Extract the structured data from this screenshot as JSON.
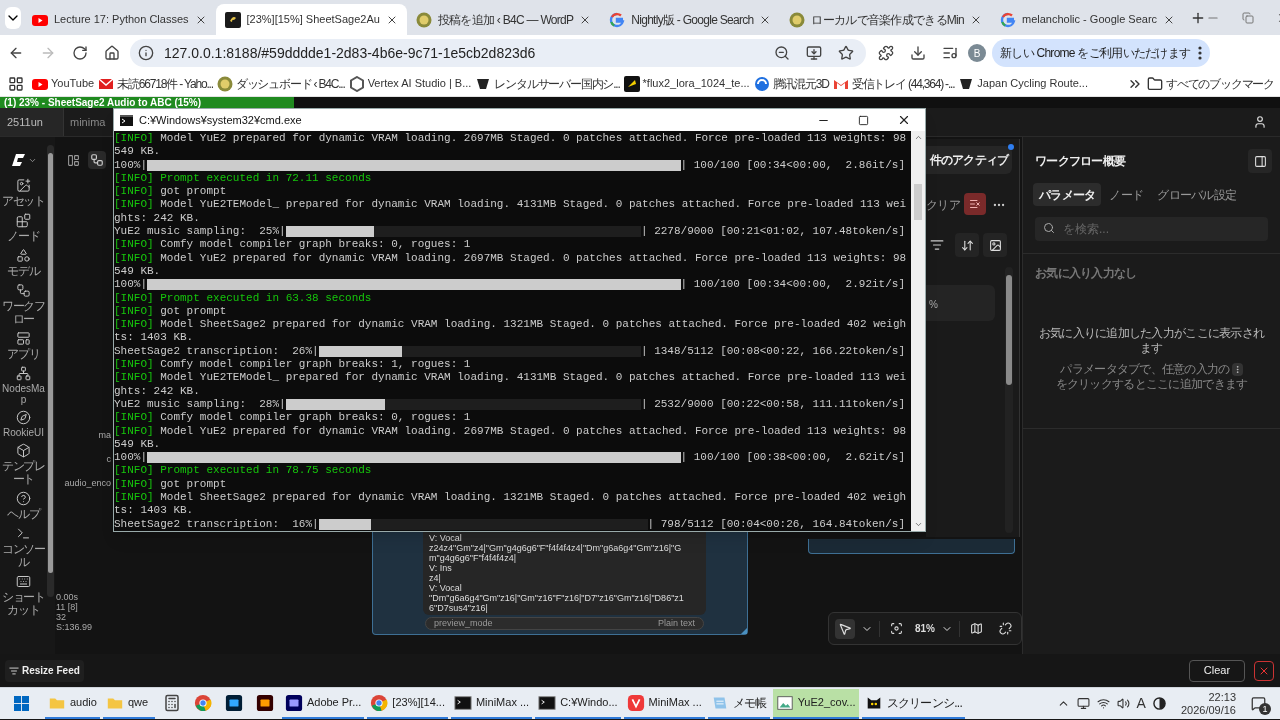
{
  "browser": {
    "tabs": [
      {
        "title": "Lecture 17: Python Classes",
        "kind": "youtube",
        "selected": false
      },
      {
        "title": "[23%][15%] SheetSage2Au",
        "kind": "app",
        "selected": true
      },
      {
        "title": "投稿を追加 ‹ B4C — WordP",
        "kind": "badge",
        "selected": false
      },
      {
        "title": "Nightly版 - Google Search",
        "kind": "google",
        "selected": false
      },
      {
        "title": "ローカルで音楽作成できるMin",
        "kind": "badge",
        "selected": false
      },
      {
        "title": "melancholic - Google Searc",
        "kind": "google",
        "selected": false
      }
    ],
    "url": "127.0.0.1:8188/#59dddde1-2d83-4b6e-9c71-1e5cb2d823d6",
    "profile": "B",
    "update_button": "新しい Chrome をご利用いただけます",
    "bookmarks": [
      {
        "label": "YouTube",
        "kind": "youtube"
      },
      {
        "label": "未読66718件 - Yaho...",
        "kind": "mail"
      },
      {
        "label": "ダッシュボード ‹ B4C...",
        "kind": "badge"
      },
      {
        "label": "Vertex AI Studio | B...",
        "kind": "hexagon"
      },
      {
        "label": "レンタルサーバー国内シ...",
        "kind": "dark"
      },
      {
        "label": "*flux2_lora_1024_te...",
        "kind": "flux"
      },
      {
        "label": "腾讯混元3D",
        "kind": "swirl"
      },
      {
        "label": "受信トレイ (44,364) -...",
        "kind": "gmail"
      },
      {
        "label": "Japan Cycling Route...",
        "kind": "dark"
      }
    ],
    "all_bookmarks": "すべてのブックマーク"
  },
  "app": {
    "progress": {
      "text": "(1) 23% - SheetSage2 Audio to ABC (15%)",
      "level": 0.23
    },
    "workflow_tabs": [
      {
        "label": "2511un",
        "selected": true
      },
      {
        "label": "minima",
        "selected": false
      }
    ],
    "sidebar": [
      {
        "label": "アセット",
        "kind": "assets"
      },
      {
        "label": "ノード",
        "kind": "nodes"
      },
      {
        "label": "モデル",
        "kind": "models"
      },
      {
        "label": "ワークフロー",
        "kind": "workflow"
      },
      {
        "label": "アプリ",
        "kind": "apps"
      },
      {
        "label": "NodesMap",
        "kind": "map"
      },
      {
        "label": "RookieUI",
        "kind": "compass"
      },
      {
        "label": "テンプレート",
        "kind": "templates"
      },
      {
        "label": "ヘルプ",
        "kind": "help"
      },
      {
        "label": "コンソール",
        "kind": "console"
      },
      {
        "label": "ショートカット",
        "kind": "keyboard"
      }
    ],
    "canvas": {
      "node_labels": [
        "ma",
        "c",
        "audio_enco"
      ],
      "stats": [
        "0.00s",
        "11 [8]",
        "32",
        "S:136.99"
      ],
      "preview_lines": [
        "V: Vocal",
        "z24z4\"Gm\"z4|\"Gm\"g4g6g6\"F\"f4f4f4z4|\"Dm\"g6a6g4\"Gm\"z16|\"Gm\"g4g6g6\"F\"f4f4f4z4|",
        "V: Ins",
        "z4|",
        "V: Vocal",
        "\"Dm\"g6a6g4\"Gm\"z16|\"Gm\"z16\"F\"z16|\"D7\"z16\"Gm\"z16|\"D86\"z16\"D7sus4\"z16|"
      ],
      "preview_mode": "preview_mode",
      "preview_format": "Plain text"
    },
    "queue": {
      "active_label": "件のアクティブ",
      "clear_label": "クリア",
      "card_text": "%"
    },
    "panel": {
      "title": "ワークフロー概要",
      "tabs": [
        {
          "label": "パラメータ",
          "selected": true
        },
        {
          "label": "ノード",
          "selected": false
        },
        {
          "label": "グローバル設定",
          "selected": false
        }
      ],
      "search_placeholder": "を検索...",
      "empty_title": "お気に入り入力なし",
      "empty_message": "お気に入りに追加した入力がここに表示されます",
      "hint_before": "パラメータタブで、任意の入力の",
      "hint_after": "をクリックするとここに追加できます"
    },
    "zoom": "81%",
    "resize_feed": "Resize Feed",
    "clear_button": "Clear"
  },
  "console": {
    "title": "C:¥Windows¥system32¥cmd.exe",
    "lines": [
      {
        "kind": "info",
        "tag": "[INFO]",
        "text": "Model YuE2 prepared for dynamic VRAM loading. 2697MB Staged. 0 patches attached. Force pre-loaded 113 weights: 98",
        "highlight": false
      },
      {
        "kind": "text",
        "text": "549 KB."
      },
      {
        "kind": "progress",
        "prefix": "100%|",
        "level": 1,
        "suffix": "| 100/100 [00:34<00:00,  2.86it/s]"
      },
      {
        "kind": "info",
        "tag": "[INFO]",
        "text": "Prompt executed in 72.11 seconds",
        "highlight": true
      },
      {
        "kind": "info",
        "tag": "[INFO]",
        "text": "got prompt",
        "highlight": false
      },
      {
        "kind": "info",
        "tag": "[INFO]",
        "text": "Model YuE2TEModel_ prepared for dynamic VRAM loading. 4131MB Staged. 0 patches attached. Force pre-loaded 113 wei",
        "highlight": false
      },
      {
        "kind": "text",
        "text": "ghts: 242 KB."
      },
      {
        "kind": "progress",
        "prefix": "YuE2 music sampling:  25%|",
        "level": 0.25,
        "suffix": "| 2278/9000 [00:21<01:02, 107.48token/s]"
      },
      {
        "kind": "info",
        "tag": "[INFO]",
        "text": "Comfy model compiler graph breaks: 0, rogues: 1",
        "highlight": false
      },
      {
        "kind": "info",
        "tag": "[INFO]",
        "text": "Model YuE2 prepared for dynamic VRAM loading. 2697MB Staged. 0 patches attached. Force pre-loaded 113 weights: 98",
        "highlight": false
      },
      {
        "kind": "text",
        "text": "549 KB."
      },
      {
        "kind": "progress",
        "prefix": "100%|",
        "level": 1,
        "suffix": "| 100/100 [00:34<00:00,  2.92it/s]"
      },
      {
        "kind": "info",
        "tag": "[INFO]",
        "text": "Prompt executed in 63.38 seconds",
        "highlight": true
      },
      {
        "kind": "info",
        "tag": "[INFO]",
        "text": "got prompt",
        "highlight": false
      },
      {
        "kind": "info",
        "tag": "[INFO]",
        "text": "Model SheetSage2 prepared for dynamic VRAM loading. 1321MB Staged. 0 patches attached. Force pre-loaded 402 weigh",
        "highlight": false
      },
      {
        "kind": "text",
        "text": "ts: 1403 KB."
      },
      {
        "kind": "progress",
        "prefix": "SheetSage2 transcription:  26%|",
        "level": 0.26,
        "suffix": "| 1348/5112 [00:08<00:22, 166.22token/s]"
      },
      {
        "kind": "info",
        "tag": "[INFO]",
        "text": "Comfy model compiler graph breaks: 1, rogues: 1",
        "highlight": false
      },
      {
        "kind": "info",
        "tag": "[INFO]",
        "text": "Model YuE2TEModel_ prepared for dynamic VRAM loading. 4131MB Staged. 0 patches attached. Force pre-loaded 113 wei",
        "highlight": false
      },
      {
        "kind": "text",
        "text": "ghts: 242 KB."
      },
      {
        "kind": "progress",
        "prefix": "YuE2 music sampling:  28%|",
        "level": 0.28,
        "suffix": "| 2532/9000 [00:22<00:58, 111.11token/s]"
      },
      {
        "kind": "info",
        "tag": "[INFO]",
        "text": "Comfy model compiler graph breaks: 0, rogues: 1",
        "highlight": false
      },
      {
        "kind": "info",
        "tag": "[INFO]",
        "text": "Model YuE2 prepared for dynamic VRAM loading. 2697MB Staged. 0 patches attached. Force pre-loaded 113 weights: 98",
        "highlight": false
      },
      {
        "kind": "text",
        "text": "549 KB."
      },
      {
        "kind": "progress",
        "prefix": "100%|",
        "level": 1,
        "suffix": "| 100/100 [00:38<00:00,  2.62it/s]"
      },
      {
        "kind": "info",
        "tag": "[INFO]",
        "text": "Prompt executed in 78.75 seconds",
        "highlight": true
      },
      {
        "kind": "info",
        "tag": "[INFO]",
        "text": "got prompt",
        "highlight": false
      },
      {
        "kind": "info",
        "tag": "[INFO]",
        "text": "Model SheetSage2 prepared for dynamic VRAM loading. 1321MB Staged. 0 patches attached. Force pre-loaded 402 weigh",
        "highlight": false
      },
      {
        "kind": "text",
        "text": "ts: 1403 KB."
      },
      {
        "kind": "progress",
        "prefix": "SheetSage2 transcription:  16%|",
        "level": 0.16,
        "suffix": "| 798/5112 [00:04<00:26, 164.84token/s]"
      }
    ]
  },
  "taskbar": {
    "items": [
      {
        "label": "audio",
        "kind": "folder",
        "running": true,
        "selected": false
      },
      {
        "label": "qwe",
        "kind": "folder",
        "running": true,
        "selected": false
      },
      {
        "kind": "calculator",
        "running": false,
        "selected": false
      },
      {
        "kind": "chrome",
        "running": false,
        "selected": false
      },
      {
        "kind": "ps",
        "running": false,
        "selected": false
      },
      {
        "kind": "ai",
        "running": false,
        "selected": false
      },
      {
        "label": "Adobe Pr...",
        "kind": "pr",
        "running": true,
        "selected": false
      },
      {
        "label": "[23%][14...",
        "kind": "chrome",
        "running": true,
        "selected": false
      },
      {
        "label": "MiniMax ...",
        "kind": "terminal",
        "running": true,
        "selected": false
      },
      {
        "label": "C:¥Windo...",
        "kind": "terminal",
        "running": true,
        "selected": false
      },
      {
        "label": "MiniMax ...",
        "kind": "vivaldi",
        "running": true,
        "selected": false
      },
      {
        "label": "メモ帳",
        "kind": "notepad",
        "running": true,
        "selected": false
      },
      {
        "label": "YuE2_cov...",
        "kind": "image",
        "running": true,
        "selected": true
      },
      {
        "label": "スクリーンシ...",
        "kind": "cat",
        "running": true,
        "selected": false
      }
    ],
    "ime": "A",
    "time": "22:13",
    "date": "2026/09/16",
    "notifications": "1"
  }
}
